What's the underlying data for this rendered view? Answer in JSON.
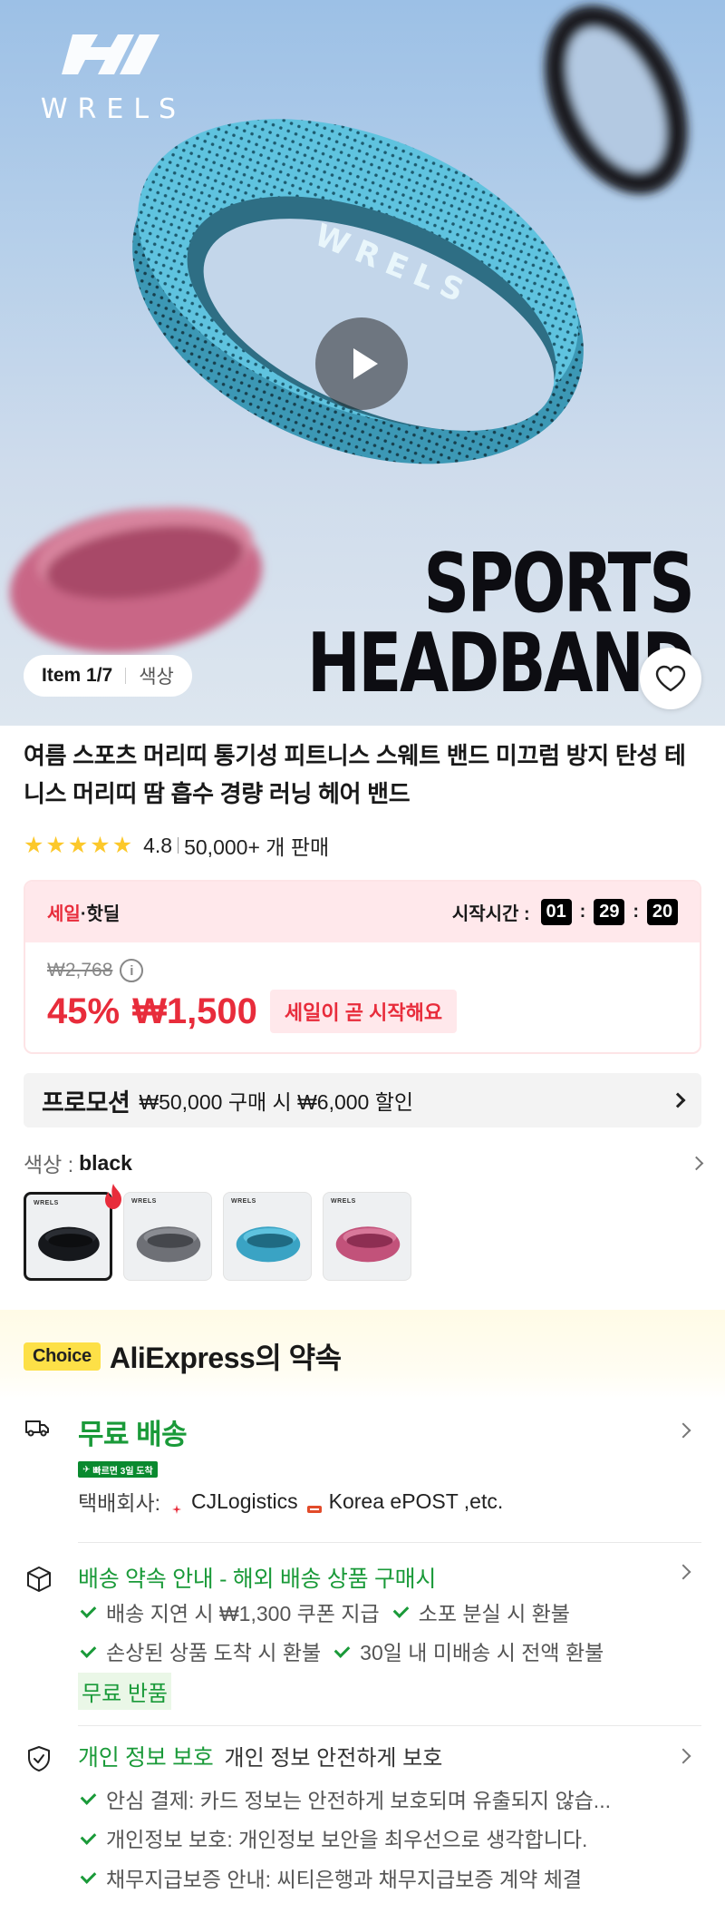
{
  "hero": {
    "brand": "WRELS",
    "headline_line1": "SPORTS",
    "headline_line2": "HEADBAND",
    "item_counter": "Item 1/7",
    "item_label": "색상"
  },
  "product": {
    "title": "여름 스포츠 머리띠 통기성 피트니스 스웨트 밴드 미끄럼 방지 탄성 테니스 머리띠 땀 흡수 경량 러닝 헤어 밴드",
    "rating": "4.8",
    "sold": "50,000+ 개 판매",
    "star_count": 5
  },
  "sale": {
    "tag_sale": "세일",
    "tag_dot": "·",
    "tag_hot": "핫딜",
    "countdown_label": "시작시간 :",
    "hours": "01",
    "minutes": "29",
    "seconds": "20",
    "original_price": "₩2,768",
    "discount": "45%",
    "price": "₩1,500",
    "soon_label": "세일이 곧 시작해요"
  },
  "promo": {
    "title": "프로모션",
    "text": "₩50,000 구매 시 ₩6,000 할인"
  },
  "color": {
    "label": "색상 :",
    "selected": "black",
    "options": [
      "black",
      "gray",
      "blue",
      "pink"
    ]
  },
  "choice": {
    "badge": "Choice",
    "title": "AliExpress의 약속"
  },
  "shipping": {
    "title": "무료 배송",
    "fast_tag": "빠르면 3일 도착",
    "carrier_label": "택배회사:",
    "carrier1": "CJLogistics",
    "carrier2": "Korea ePOST ,etc."
  },
  "delivery_promise": {
    "title": "배송 약속 안내 - 해외 배송 상품 구매시",
    "items": [
      "배송 지연 시 ₩1,300 쿠폰 지급",
      "소포 분실 시 환불",
      "손상된 상품 도착 시 환불",
      "30일 내 미배송 시 전액 환불"
    ],
    "free_return": "무료 반품"
  },
  "privacy": {
    "title": "개인 정보 보호",
    "subtitle": "개인 정보 안전하게 보호",
    "items": [
      "안심 결제: 카드 정보는 안전하게 보호되며 유출되지 않습...",
      "개인정보 보호: 개인정보 보안을 최우선으로 생각합니다.",
      "채무지급보증 안내: 씨티은행과 채무지급보증 계약 체결"
    ]
  },
  "colors": {
    "accent_red": "#e82c3b",
    "green": "#1a9a39",
    "choice_yellow": "#fde047",
    "headband_blue": "#4fb6d6",
    "headband_pink": "#d46a8e"
  }
}
